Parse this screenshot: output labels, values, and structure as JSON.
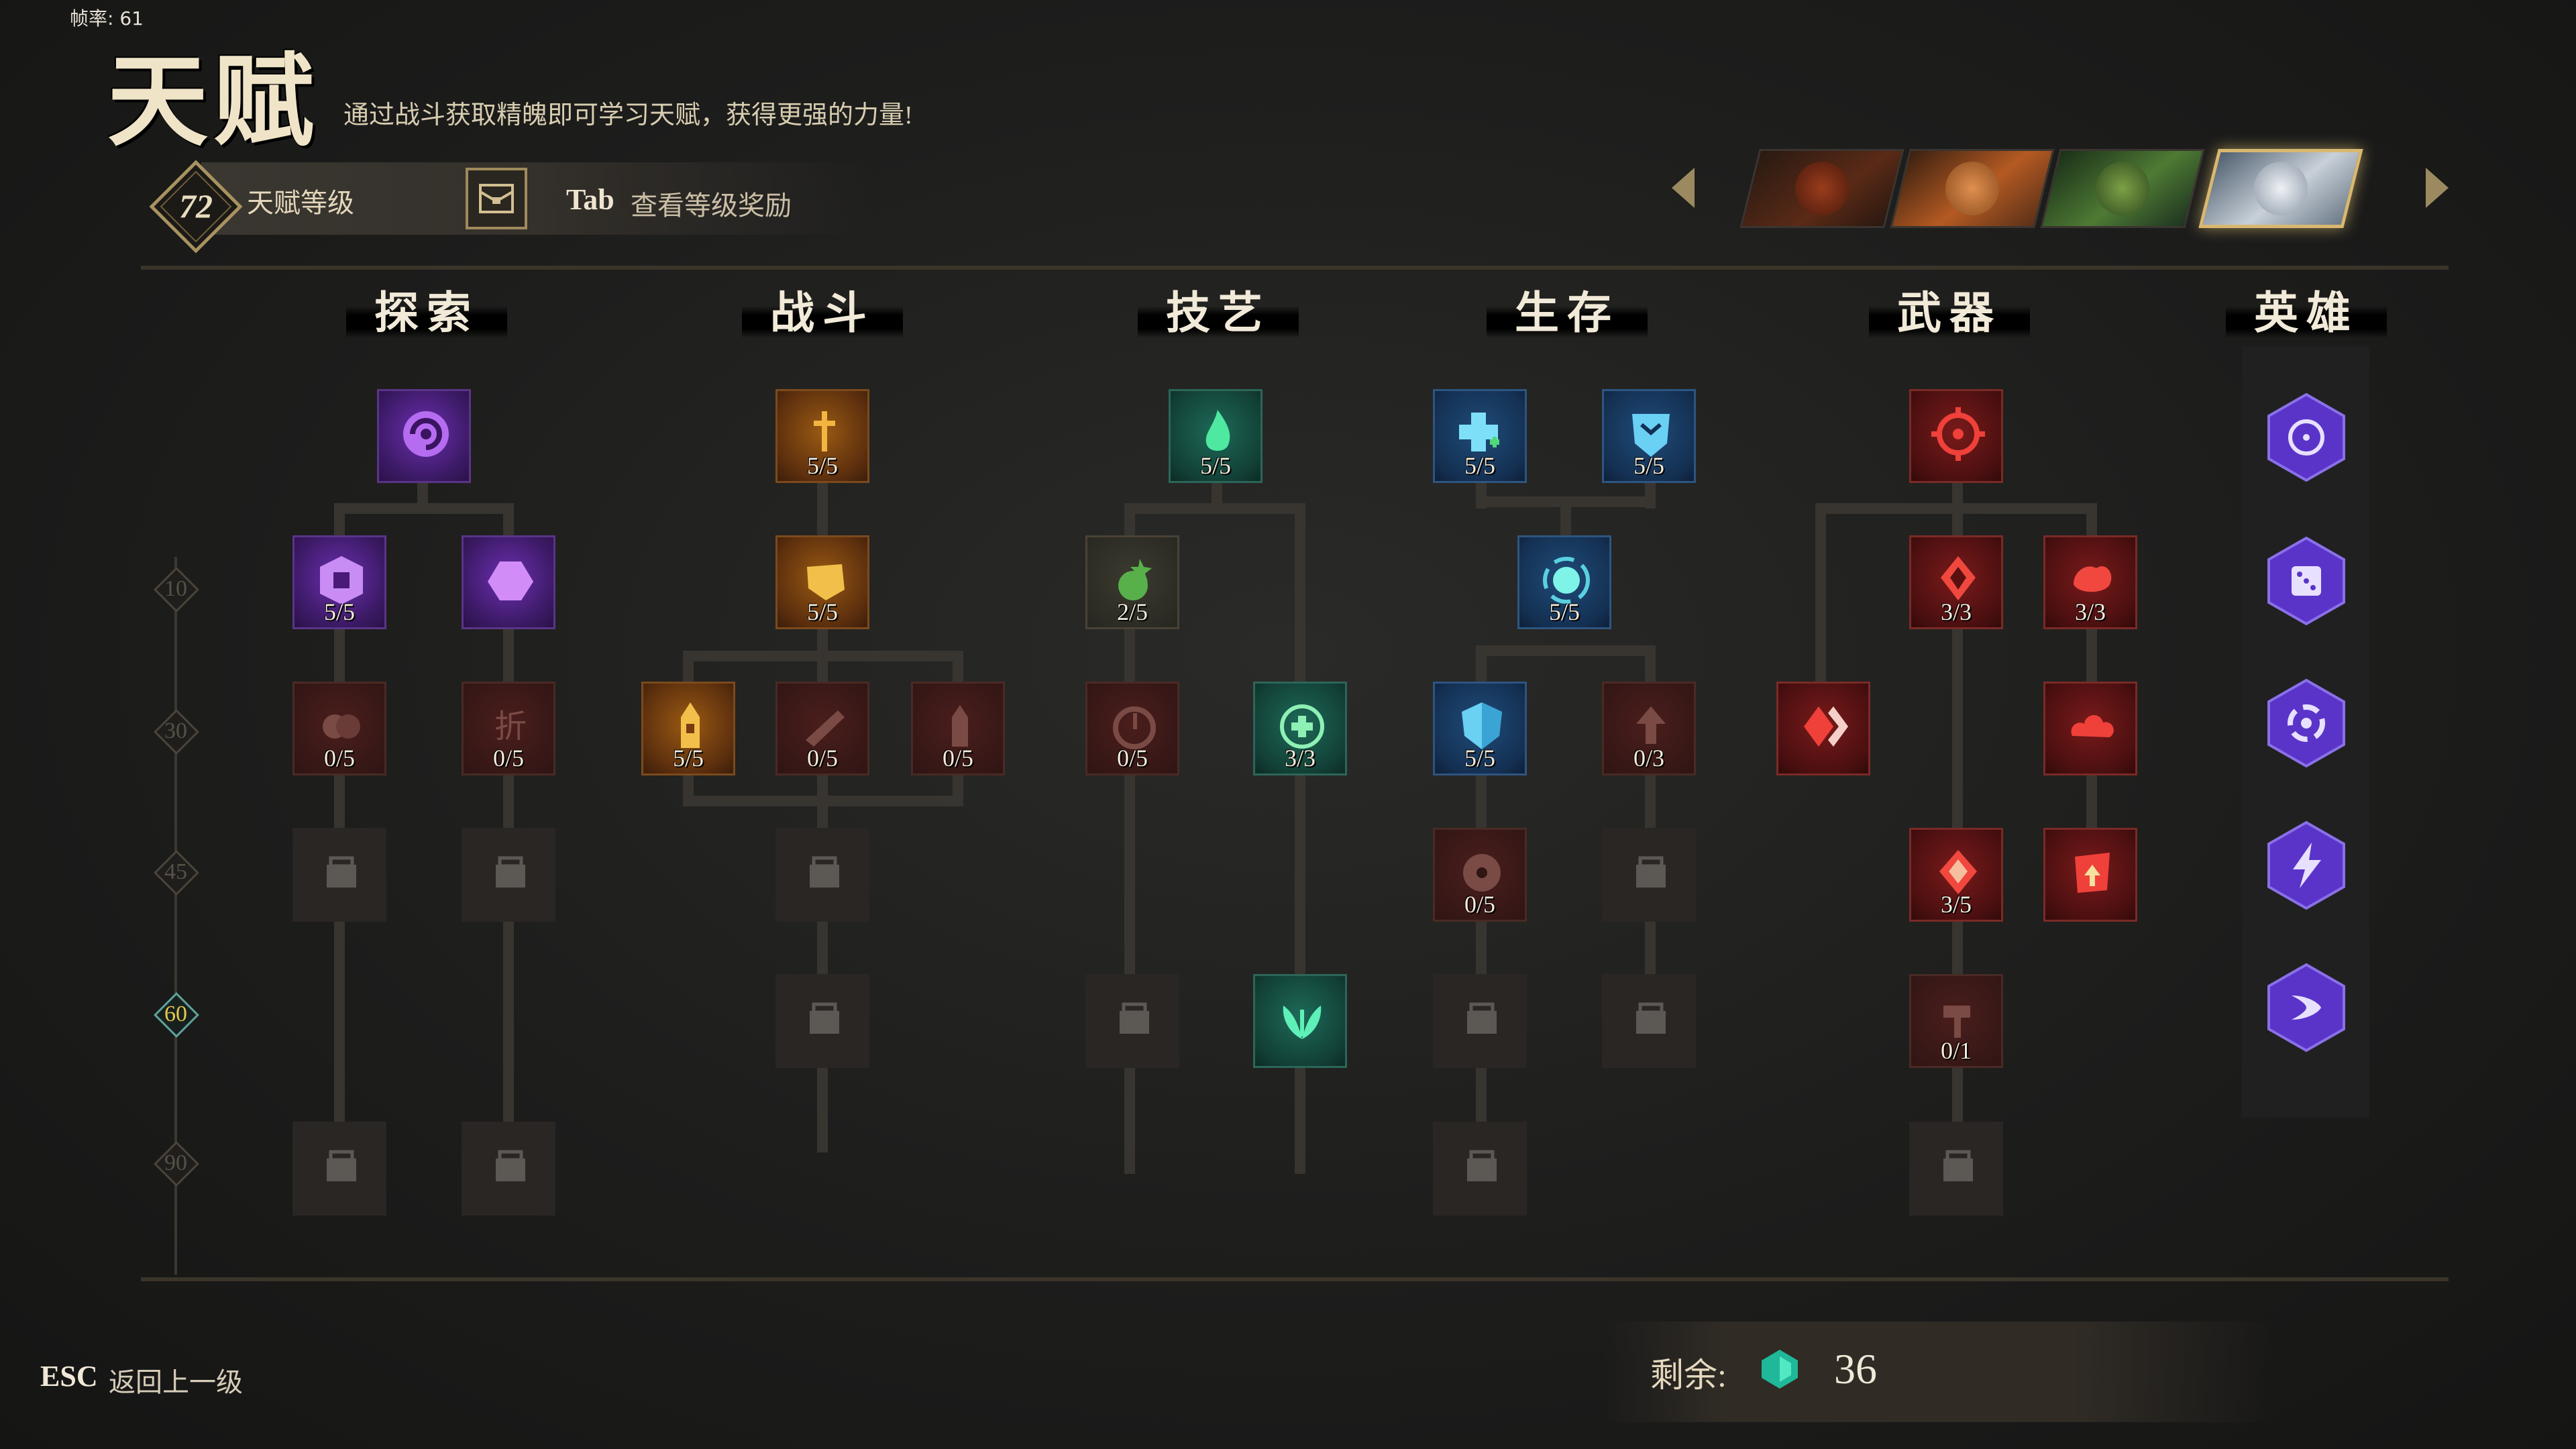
{
  "fps": "帧率: 61",
  "title": "天赋",
  "subtitle": "通过战斗获取精魄即可学习天赋，获得更强的力量!",
  "header": {
    "level": "72",
    "level_label": "天赋等级",
    "tab_key": "Tab",
    "tab_text": "查看等级奖励"
  },
  "heroes": [
    "hero-red",
    "hero-fox",
    "hero-green",
    "hero-white"
  ],
  "categories": [
    "探索",
    "战斗",
    "技艺",
    "生存",
    "武器",
    "英雄"
  ],
  "levels": [
    "10",
    "30",
    "45",
    "60",
    "90"
  ],
  "nodes": {
    "explore_r0": "",
    "explore_r1a": "5/5",
    "explore_r1b": "",
    "explore_r2a": "0/5",
    "explore_r2b": "0/5",
    "combat_r0": "5/5",
    "combat_r1": "5/5",
    "combat_r2a": "5/5",
    "combat_r2b": "0/5",
    "combat_r2c": "0/5",
    "craft_r0": "5/5",
    "craft_r1": "2/5",
    "craft_r2a": "0/5",
    "craft_r2b": "3/3",
    "survive_r0a": "5/5",
    "survive_r0b": "5/5",
    "survive_r1": "5/5",
    "survive_r2a": "5/5",
    "survive_r2b": "0/3",
    "survive_r3": "0/5",
    "weapon_r1a": "3/3",
    "weapon_r1b": "3/3",
    "weapon_r3": "3/5",
    "weapon_r4": "0/1"
  },
  "footer": {
    "esc_key": "ESC",
    "esc_text": "返回上一级",
    "remain_label": "剩余:",
    "remain_value": "36"
  },
  "colors": {
    "accent_gold": "#d8b870",
    "purple": "#6b2fb0",
    "teal": "#1d6a58",
    "red": "#7a1a1a",
    "level_active": "#e6c84a"
  }
}
